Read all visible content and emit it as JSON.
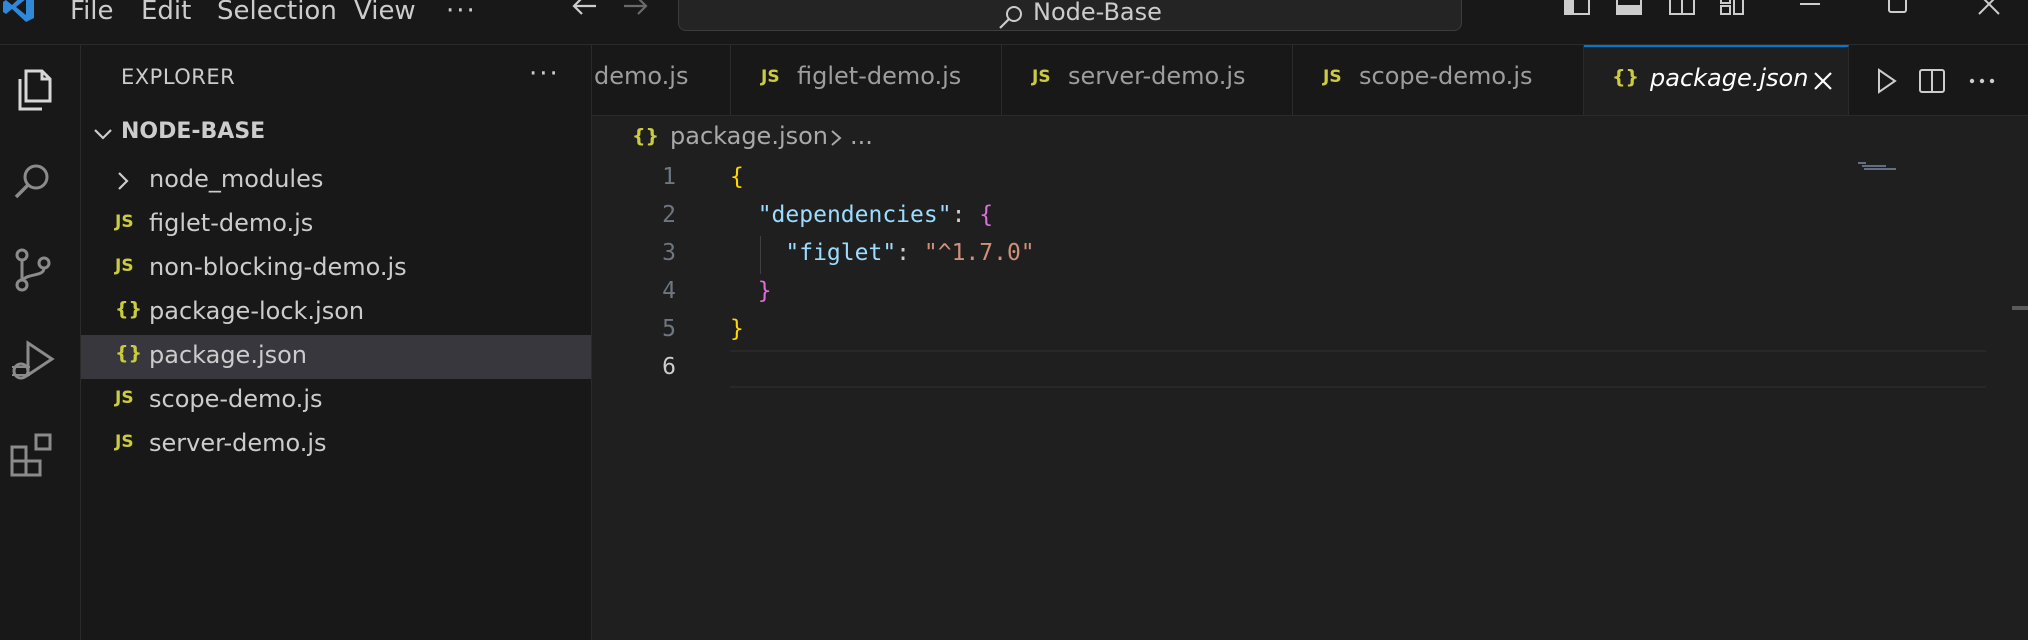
{
  "titlebar": {
    "menu": [
      "File",
      "Edit",
      "Selection",
      "View"
    ],
    "more": "···",
    "search_text": "Node-Base"
  },
  "sidebar": {
    "title": "EXPLORER",
    "more": "···",
    "root": "NODE-BASE",
    "items": [
      {
        "label": "node_modules",
        "type": "folder"
      },
      {
        "label": "figlet-demo.js",
        "type": "js",
        "icon_text": "JS"
      },
      {
        "label": "non-blocking-demo.js",
        "type": "js",
        "icon_text": "JS"
      },
      {
        "label": "package-lock.json",
        "type": "json",
        "icon_text": "{}"
      },
      {
        "label": "package.json",
        "type": "json",
        "icon_text": "{}",
        "selected": true
      },
      {
        "label": "scope-demo.js",
        "type": "js",
        "icon_text": "JS"
      },
      {
        "label": "server-demo.js",
        "type": "js",
        "icon_text": "JS"
      }
    ]
  },
  "tabs": [
    {
      "label": "demo.js",
      "icon_text": ""
    },
    {
      "label": "figlet-demo.js",
      "icon_text": "JS"
    },
    {
      "label": "server-demo.js",
      "icon_text": "JS"
    },
    {
      "label": "scope-demo.js",
      "icon_text": "JS"
    },
    {
      "label": "package.json",
      "icon_text": "{}",
      "active": true
    }
  ],
  "breadcrumb": {
    "icon_text": "{}",
    "file": "package.json",
    "more": "..."
  },
  "editor": {
    "line_numbers": [
      "1",
      "2",
      "3",
      "4",
      "5",
      "6"
    ],
    "tokens": {
      "l1_open": "{",
      "l2_key": "\"dependencies\"",
      "l2_colon": ": ",
      "l2_open": "{",
      "l3_key": "\"figlet\"",
      "l3_colon": ": ",
      "l3_value": "\"^1.7.0\"",
      "l4_close": "}",
      "l5_close": "}"
    }
  },
  "colors": {
    "accent": "#0078d4",
    "json_icon": "#cbcb41",
    "js_icon": "#cbcb41",
    "key": "#9cdcfe",
    "string": "#ce9178",
    "brace_level1": "#ffd700",
    "brace_level2": "#da70d6"
  }
}
